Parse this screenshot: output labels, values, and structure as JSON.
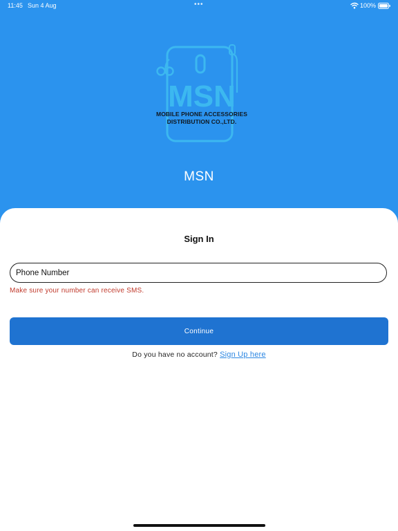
{
  "status_bar": {
    "time": "11:45",
    "date": "Sun 4 Aug",
    "dots": "•••",
    "battery": "100%"
  },
  "header": {
    "logo": {
      "brand": "MSN",
      "line1": "MOBILE PHONE ACCESSORIES",
      "line2": "DISTRIBUTION CO.,LTD."
    },
    "title": "MSN"
  },
  "sign_in": {
    "title": "Sign In",
    "phone_placeholder": "Phone Number",
    "phone_value": "",
    "helper": "Make sure your number can receive SMS.",
    "continue_label": "Continue",
    "no_account_text": "Do you have no account?",
    "signup_link": "Sign Up here"
  },
  "colors": {
    "header_background": "#2b93ee",
    "logo_outline": "#3cb8f0",
    "button": "#1f73d1",
    "error_text": "#c0392b",
    "link": "#2b86e2"
  }
}
